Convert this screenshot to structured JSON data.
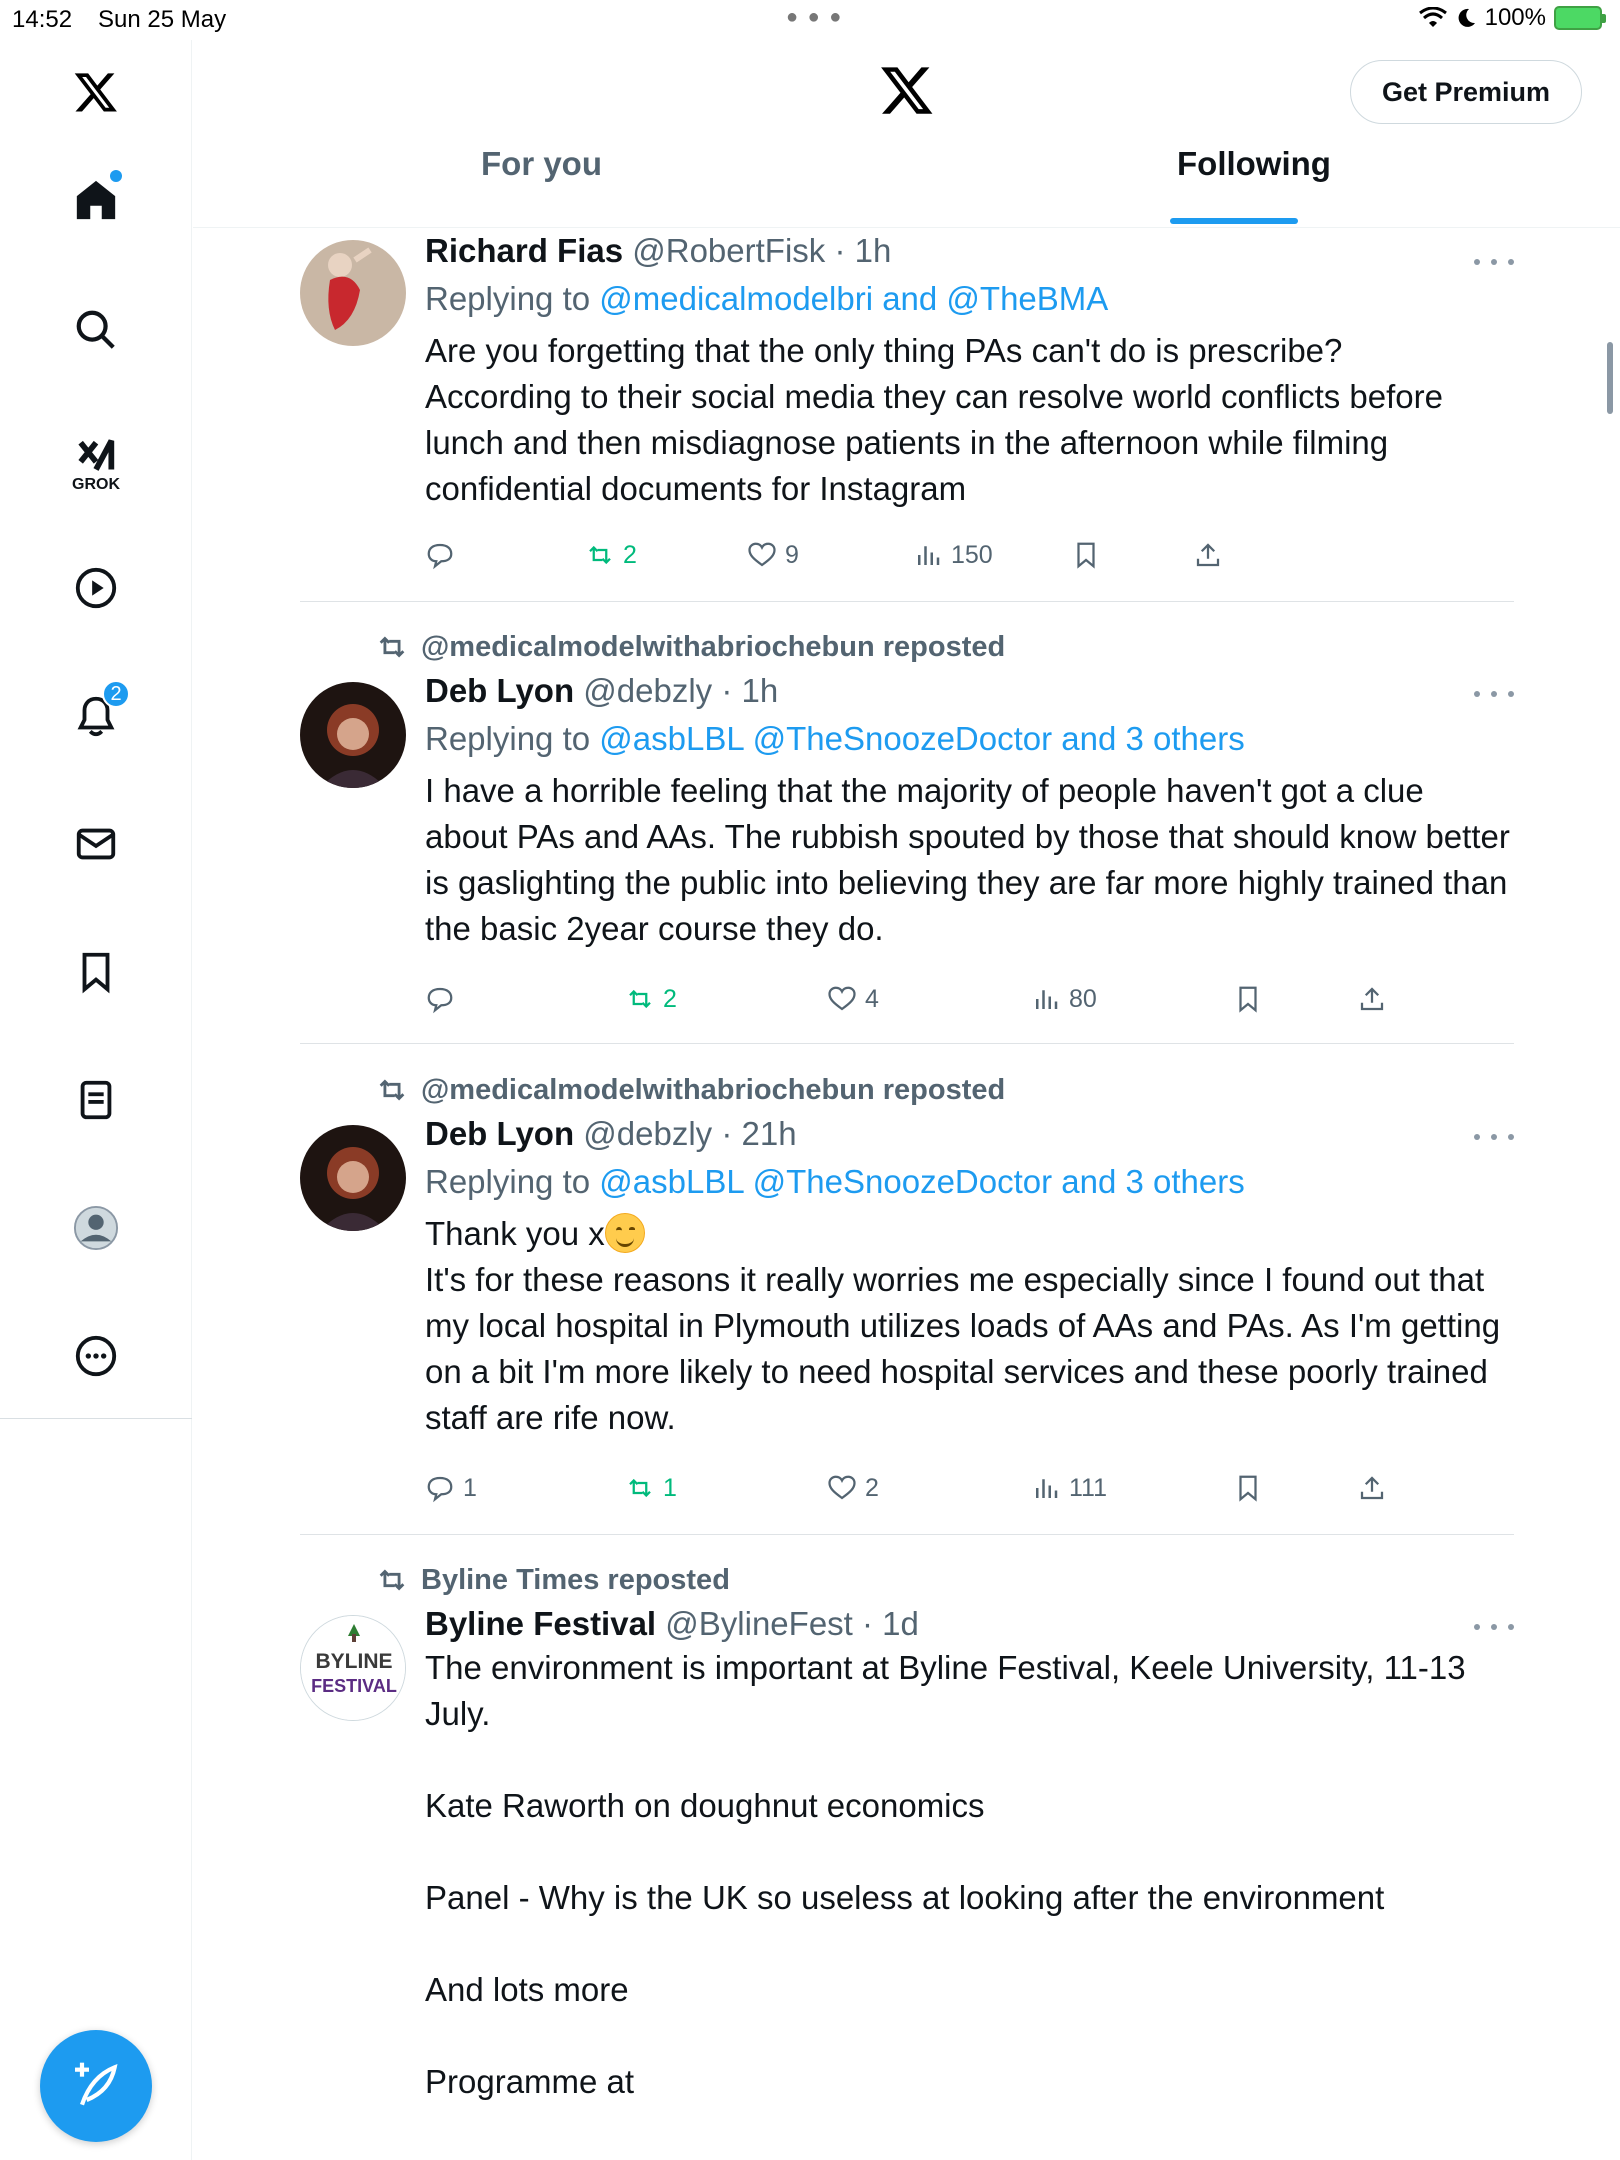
{
  "status_bar": {
    "time": "14:52",
    "date": "Sun 25 May",
    "battery": "100%"
  },
  "header": {
    "premium_button": "Get Premium",
    "tabs": [
      {
        "label": "For you"
      },
      {
        "label": "Following"
      }
    ]
  },
  "sidebar": {
    "grok_label": "GROK",
    "notifications_count": "2"
  },
  "posts": [
    {
      "name": "Richard Fias",
      "handle": "@RobertFisk · 1h",
      "replying_prefix": "Replying to ",
      "replying_to": "@medicalmodelbri and @TheBMA",
      "text": "Are you forgetting that the only thing PAs can't do is prescribe?\nAccording to their social media they can resolve world conflicts before lunch and then misdiagnose patients in the afternoon while filming confidential documents for Instagram",
      "reply_count": "",
      "repost_count": "2",
      "like_count": "9",
      "view_count": "150"
    },
    {
      "reposted_by": "@medicalmodelwithabriochebun reposted",
      "name": "Deb Lyon",
      "handle": "@debzly · 1h",
      "replying_prefix": "Replying to ",
      "replying_to": "@asbLBL @TheSnoozeDoctor and 3 others",
      "text": "I have a horrible feeling that the majority of people haven't got a clue about PAs and AAs. The rubbish spouted by those that should know better is gaslighting the public into believing they are far more highly trained than the basic 2year course they do.",
      "reply_count": "",
      "repost_count": "2",
      "like_count": "4",
      "view_count": "80"
    },
    {
      "reposted_by": "@medicalmodelwithabriochebun reposted",
      "name": "Deb Lyon",
      "handle": "@debzly · 21h",
      "replying_prefix": "Replying to ",
      "replying_to": "@asbLBL @TheSnoozeDoctor and 3 others",
      "text_first": "Thank you x",
      "text": "It's for these reasons it really worries me especially since I found out that my local hospital in Plymouth utilizes loads of AAs and PAs. As I'm getting on a bit I'm more likely to need hospital services and these poorly trained staff are rife now.",
      "reply_count": "1",
      "repost_count": "1",
      "like_count": "2",
      "view_count": "111"
    },
    {
      "reposted_by": "Byline Times reposted",
      "name": "Byline Festival",
      "handle": "@BylineFest · 1d",
      "avatar_line1": "BYLINE",
      "avatar_line2": "FESTIVAL",
      "text": "The environment is important at Byline Festival, Keele University, 11-13 July.\n\nKate Raworth on doughnut economics\n\nPanel - Why is the UK so useless at looking after the environment\n\nAnd lots more\n\nProgramme at"
    }
  ]
}
